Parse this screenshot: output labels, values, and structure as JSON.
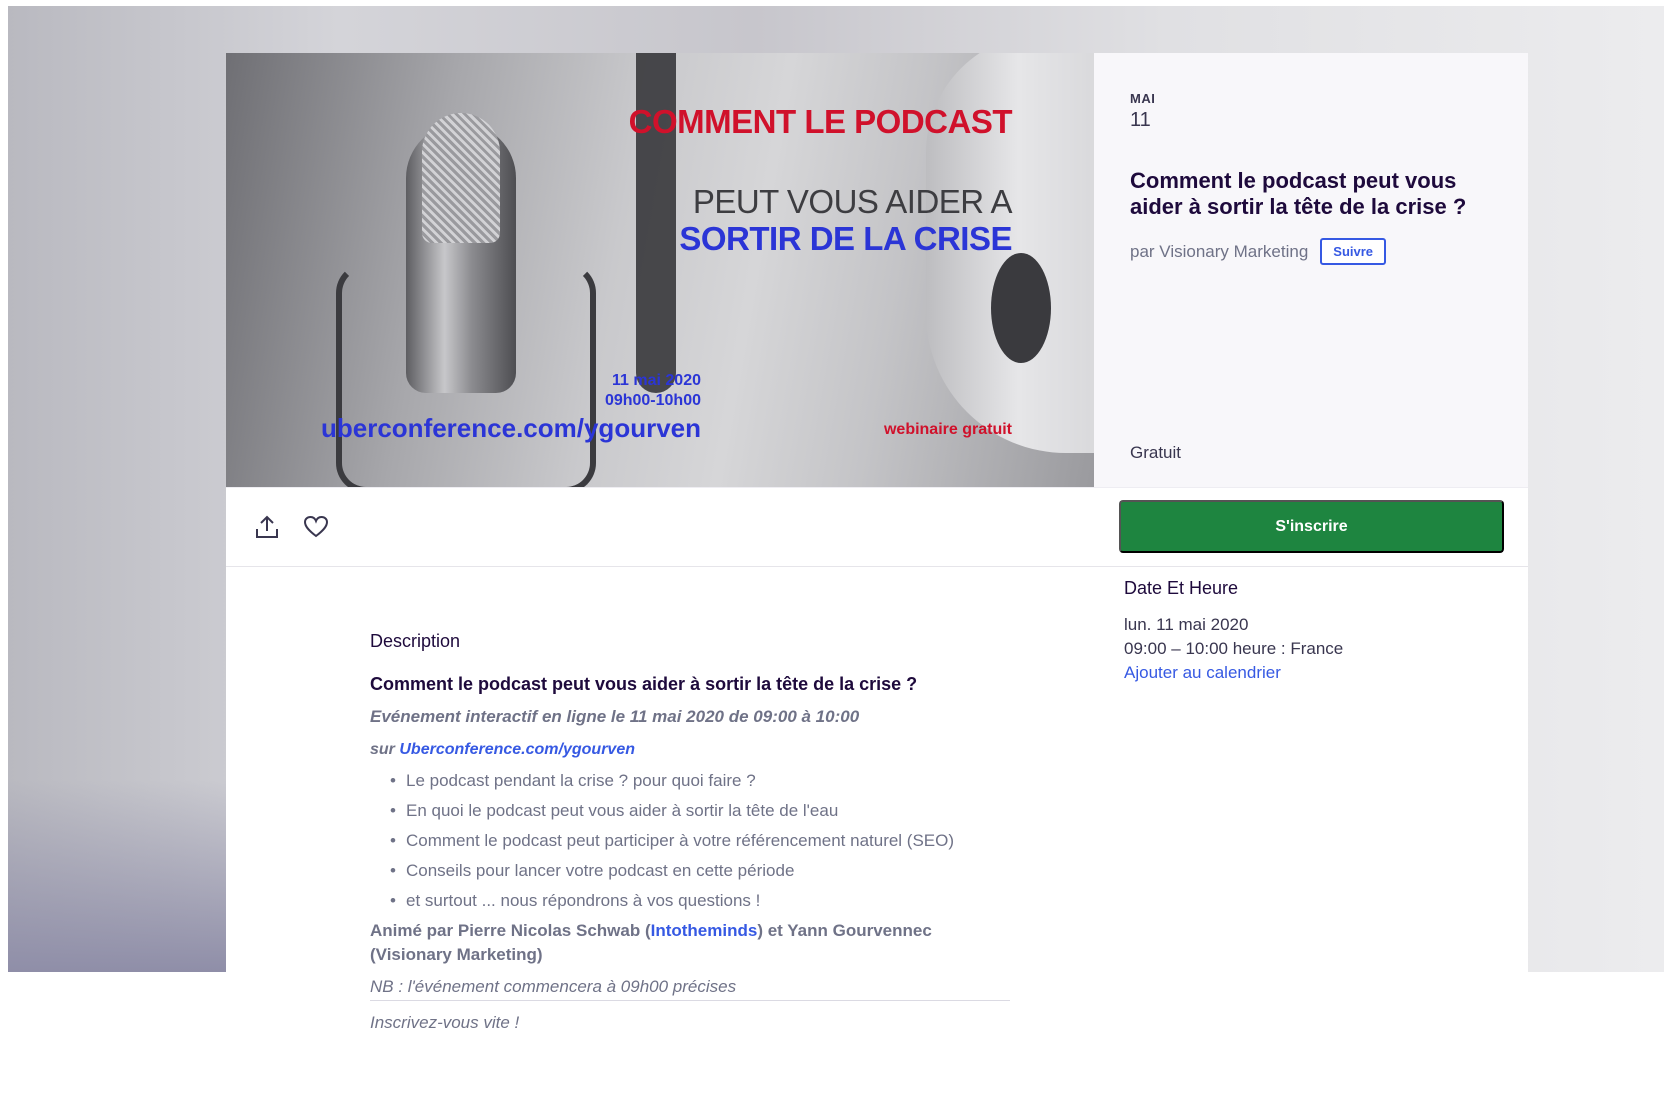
{
  "hero": {
    "title_line1": "COMMENT LE PODCAST",
    "title_line2": "PEUT VOUS AIDER A",
    "title_line3": "SORTIR DE LA CRISE",
    "date_line1": "11 mai 2020",
    "date_line2": "09h00-10h00",
    "url": "uberconference.com/ygourven",
    "free_label": "webinaire gratuit",
    "colors": {
      "red": "#d0112b",
      "blue": "#2b35d6"
    }
  },
  "side": {
    "month": "MAI",
    "day": "11",
    "title": "Comment le podcast peut vous aider à sortir la tête de la crise ?",
    "organizer": "par Visionary Marketing",
    "follow_label": "Suivre",
    "price": "Gratuit"
  },
  "actions": {
    "share_icon": "share-icon",
    "like_icon": "heart-icon",
    "register_label": "S'inscrire",
    "register_color": "#1e8540"
  },
  "description": {
    "label": "Description",
    "title": "Comment le podcast peut vous aider à sortir la tête de la crise ?",
    "event_line": "Evénement interactif en ligne le 11 mai 2020 de 09:00 à 10:00",
    "link_prefix": "sur",
    "link_text": "Uberconference.com/ygourven",
    "topics": [
      "Le podcast pendant la crise ? pour quoi faire ?",
      "En quoi le podcast peut vous aider à sortir la tête de l'eau",
      "Comment le podcast peut participer à votre référencement naturel (SEO)",
      "Conseils pour lancer votre podcast en cette période",
      "et surtout ... nous répondrons à vos questions !"
    ],
    "hosts_prefix": "Animé par Pierre Nicolas Schwab (",
    "hosts_link": "Intotheminds",
    "hosts_suffix": ") et Yann Gourvennec (Visionary Marketing)",
    "nb": "NB : l'événement commencera à 09h00 précises",
    "cta": "Inscrivez-vous vite !"
  },
  "datetime": {
    "label": "Date Et Heure",
    "date": "lun. 11 mai 2020",
    "time": "09:00 – 10:00 heure : France",
    "calendar_link": "Ajouter au calendrier"
  }
}
